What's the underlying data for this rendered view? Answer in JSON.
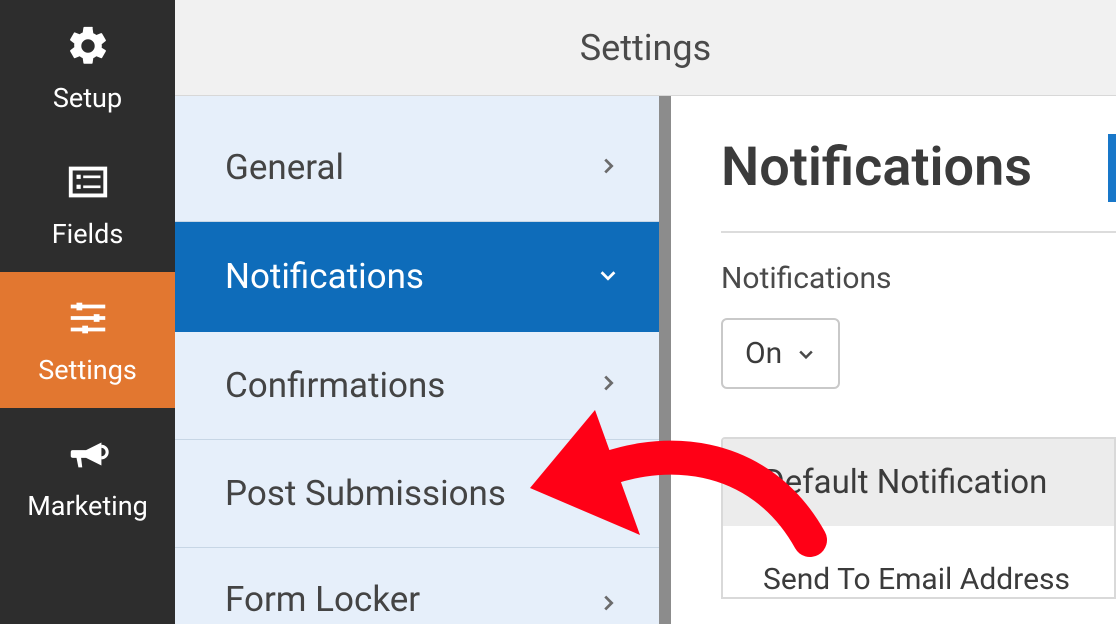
{
  "header": {
    "title": "Settings"
  },
  "sidebar": {
    "items": [
      {
        "label": "Setup",
        "icon": "gear-icon"
      },
      {
        "label": "Fields",
        "icon": "list-icon"
      },
      {
        "label": "Settings",
        "icon": "sliders-icon"
      },
      {
        "label": "Marketing",
        "icon": "megaphone-icon"
      }
    ]
  },
  "subnav": {
    "items": [
      {
        "label": "General",
        "expanded": false
      },
      {
        "label": "Notifications",
        "expanded": true
      },
      {
        "label": "Confirmations",
        "expanded": false
      },
      {
        "label": "Post Submissions",
        "expanded": false
      },
      {
        "label": "Form Locker",
        "expanded": false
      }
    ]
  },
  "detail": {
    "title": "Notifications",
    "toggle_label": "Notifications",
    "toggle_value": "On",
    "panel_header": "Default Notification",
    "send_to_label": "Send To Email Address"
  }
}
